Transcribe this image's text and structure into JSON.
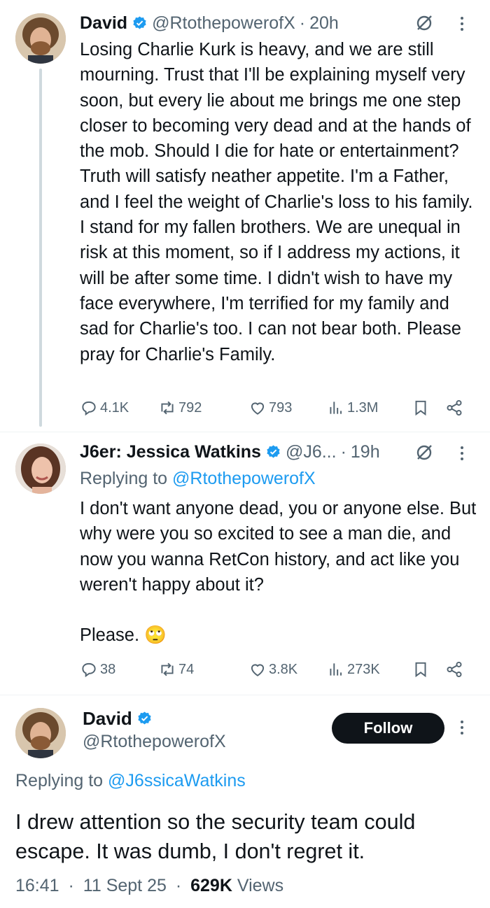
{
  "tweet1": {
    "author_name": "David",
    "handle": "@RtothepowerofX",
    "time": "20h",
    "text": "Losing Charlie Kurk is heavy, and we are still mourning. Trust that I'll be explaining myself very soon, but every lie about me brings me one step closer to becoming very dead and at the hands of the mob. Should I die for hate or entertainment? Truth will satisfy neather appetite. I'm a Father, and I feel the weight of Charlie's loss to his family. I stand for my fallen brothers. We are unequal in risk at this moment, so if I address my actions, it will be after some time. I didn't wish to have my face everywhere, I'm terrified for my family and sad for Charlie's too. I can not bear both. Please pray for Charlie's Family.",
    "replies": "4.1K",
    "reposts": "792",
    "likes": "793",
    "views": "1.3M"
  },
  "tweet2": {
    "author_name": "J6er: Jessica Watkins",
    "handle": "@J6...",
    "time": "19h",
    "replying_prefix": "Replying to ",
    "replying_handle": "@RtothepowerofX",
    "text": "I don't want anyone dead, you or anyone else. But why were you so excited to see a man die, and now you wanna RetCon history, and act like you weren't happy about it?\n\nPlease. 🙄",
    "replies": "38",
    "reposts": "74",
    "likes": "3.8K",
    "views": "273K"
  },
  "main_tweet": {
    "author_name": "David",
    "handle": "@RtothepowerofX",
    "follow_label": "Follow",
    "replying_prefix": "Replying to ",
    "replying_handle": "@J6ssicaWatkins",
    "text": "I drew attention so the security team could escape. It was dumb, I don't regret it.",
    "time": "16:41",
    "date": "11 Sept 25",
    "views_count": "629K",
    "views_label": "Views"
  },
  "separator": "·",
  "icons": {
    "verified": "verified-badge-icon",
    "grok": "grok-icon",
    "more": "more-icon",
    "reply": "reply-icon",
    "repost": "repost-icon",
    "like": "like-icon",
    "views": "views-icon",
    "bookmark": "bookmark-icon",
    "share": "share-icon"
  },
  "colors": {
    "accent": "#1d9bf0",
    "text": "#0f1419",
    "muted": "#536471",
    "thread_line": "#cfd9de",
    "follow_button": "#0f1419"
  }
}
